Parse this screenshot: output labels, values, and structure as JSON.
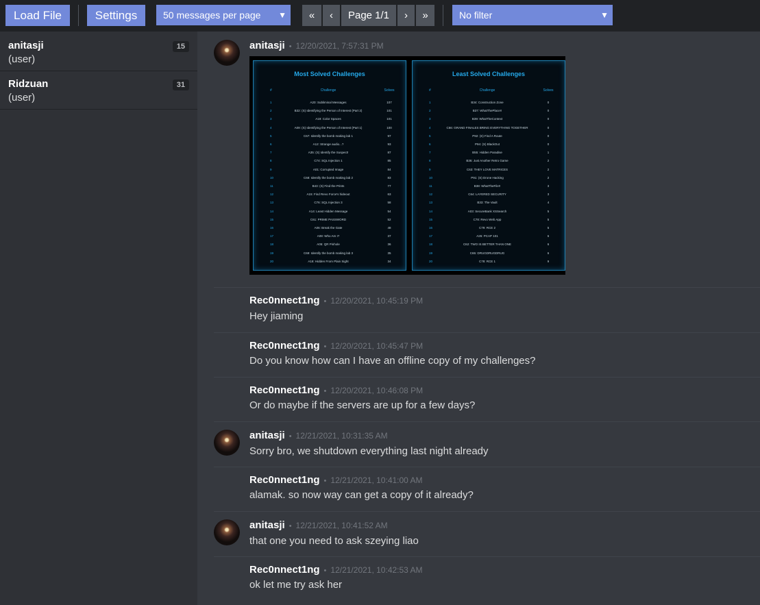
{
  "toolbar": {
    "load_file": "Load File",
    "settings": "Settings",
    "per_page": "50 messages per page",
    "first": "«",
    "prev": "‹",
    "page": "Page 1/1",
    "next": "›",
    "last": "»",
    "filter": "No filter"
  },
  "icons": {
    "avatar": "avatar-image"
  },
  "channels": [
    {
      "name": "anitasji",
      "type": "(user)",
      "count": "15"
    },
    {
      "name": "Ridzuan",
      "type": "(user)",
      "count": "31"
    }
  ],
  "messages": [
    {
      "author": "anitasji",
      "time": "12/20/2021, 7:57:31 PM",
      "text": ""
    },
    {
      "author": "Rec0nnect1ng",
      "time": "12/20/2021, 10:45:19 PM",
      "text": "Hey jiaming"
    },
    {
      "author": "Rec0nnect1ng",
      "time": "12/20/2021, 10:45:47 PM",
      "text": "Do you know how can I have an offline copy of my challenges?"
    },
    {
      "author": "Rec0nnect1ng",
      "time": "12/20/2021, 10:46:08 PM",
      "text": "Or do maybe if the servers are up for a few days?"
    },
    {
      "author": "anitasji",
      "time": "12/21/2021, 10:31:35 AM",
      "text": "Sorry bro,  we shutdown everything last night already"
    },
    {
      "author": "Rec0nnect1ng",
      "time": "12/21/2021, 10:41:00 AM",
      "text": "alamak. so now way can get a copy of it already?"
    },
    {
      "author": "anitasji",
      "time": "12/21/2021, 10:41:52 AM",
      "text": "that one you need to ask szeying liao"
    },
    {
      "author": "Rec0nnect1ng",
      "time": "12/21/2021, 10:42:53 AM",
      "text": "ok let me try ask her"
    }
  ],
  "attachment": {
    "headers": {
      "num": "#",
      "challenge": "Challenge",
      "solves": "Solves"
    },
    "left": {
      "title": "Most Solved Challenges",
      "rows": [
        [
          "1",
          "A20: Subliminal Messages",
          "107"
        ],
        [
          "2",
          "B32: (S) Identifying the Person of Interest (Part 2)",
          "101"
        ],
        [
          "3",
          "A19: Color Spaces",
          "101"
        ],
        [
          "4",
          "A09: (S) Identifying the Person of Interest (Part 1)",
          "100"
        ],
        [
          "5",
          "C67: Identify the bomb making lab 1",
          "97"
        ],
        [
          "6",
          "A12: Strange audio...?",
          "93"
        ],
        [
          "7",
          "A35: (S) Identify the Suspect!",
          "87"
        ],
        [
          "8",
          "C74: SQL Injection 1",
          "85"
        ],
        [
          "9",
          "A01: Corrupted Image",
          "84"
        ],
        [
          "10",
          "C68: Identify the bomb making lab 2",
          "83"
        ],
        [
          "11",
          "B43: (S) Find the Prints",
          "77"
        ],
        [
          "12",
          "A15: Find Revo Force's hideout",
          "63"
        ],
        [
          "13",
          "C76: SQL Injection 3",
          "58"
        ],
        [
          "14",
          "A14: Least Hidden Message",
          "54"
        ],
        [
          "15",
          "C61: PRIME PASSWORD",
          "52"
        ],
        [
          "16",
          "A06: Break the Gate",
          "48"
        ],
        [
          "17",
          "A08: Who Am I?",
          "37"
        ],
        [
          "18",
          "A05: QR Pinhole",
          "36"
        ],
        [
          "19",
          "C69: Identify the bomb making lab 3",
          "35"
        ],
        [
          "20",
          "A18: Hidden From Plain Sight",
          "34"
        ]
      ]
    },
    "right": {
      "title": "Least Solved Challenges",
      "rows": [
        [
          "1",
          "B34: Construction Zone",
          "0"
        ],
        [
          "2",
          "B37: WhatThePlace!!",
          "0"
        ],
        [
          "3",
          "B39: WhatTheContext",
          "0"
        ],
        [
          "4",
          "C66: GRAND FINALES BRING EVERYTHING TOGETHER",
          "0"
        ],
        [
          "5",
          "P92: (S) Find A Route",
          "0"
        ],
        [
          "6",
          "P94: (S) BlackOut",
          "0"
        ],
        [
          "7",
          "B55: Hidden Paradise",
          "1"
        ],
        [
          "8",
          "B36: Just Another Retro Game",
          "2"
        ],
        [
          "9",
          "C63: THEY LOVE MATRICES",
          "2"
        ],
        [
          "10",
          "P91: (S) Drone Hacking",
          "2"
        ],
        [
          "11",
          "B38: WhatTheFile!!",
          "3"
        ],
        [
          "12",
          "C64: LAYERED SECURITY",
          "3"
        ],
        [
          "13",
          "B33: The Vault",
          "4"
        ],
        [
          "14",
          "A03: SecureBank XSSearch",
          "5"
        ],
        [
          "15",
          "C78: Revo Web App",
          "5"
        ],
        [
          "16",
          "C79: RCE 2",
          "5"
        ],
        [
          "17",
          "A26: PCAP 101",
          "6"
        ],
        [
          "18",
          "C62: TWO IS BETTER THAN ONE",
          "6"
        ],
        [
          "19",
          "C65: DRUGDRUGDRUG",
          "6"
        ],
        [
          "20",
          "C78: RCE 1",
          "9"
        ]
      ]
    }
  }
}
